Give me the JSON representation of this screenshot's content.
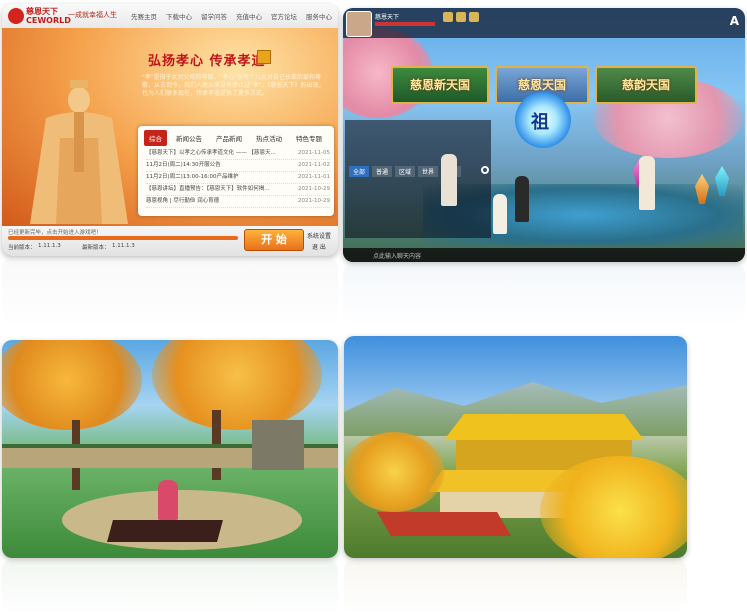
{
  "launcher": {
    "logo_text": "慈恩天下\nCEWORLD",
    "slogan": "一成就幸福人生",
    "nav": [
      "先赛主页",
      "下载中心",
      "留学问答",
      "充值中心",
      "官方论坛",
      "服务中心"
    ],
    "headline": "弘扬孝心 传承孝道",
    "intro": "\"孝\"是指子女对父母的尊敬，\"孝心\"是每个儿女对自己长辈的爱和尊敬，从古到今，我们人类从来没有停止过\"孝\"。《慈恩天下》的出现，也为人们很多现在，传承孝道提供了更多方式。",
    "tabs": [
      "综合",
      "新闻公告",
      "产品新闻",
      "热点活动",
      "特色专题"
    ],
    "active_tab": 0,
    "news": [
      {
        "title": "【慈恩天下】以孝之心传承孝道文化 —— 【慈恩天...",
        "date": "2021-11-05"
      },
      {
        "title": "11月2日(周二)14:30开服公告",
        "date": "2021-11-02"
      },
      {
        "title": "11月2日(周二)13:00-16:00产品维护",
        "date": "2021-11-01"
      },
      {
        "title": "【慈恩讲坛】直播预告：【慈恩天下】软件如何揭...",
        "date": "2021-10-29"
      },
      {
        "title": "慈恩视角 | 尽行勤俭 润心育德",
        "date": "2021-10-29"
      }
    ],
    "status_text": "已经更新完毕，点击开始进入游戏吧！",
    "progress": 1.0,
    "current_version_label": "当前版本：",
    "current_version": "1.11.1.3",
    "latest_version_label": "最新版本：",
    "latest_version": "1.11.1.3",
    "start_label": "开 始",
    "settings_label": "系统设置",
    "exit_label": "退 出"
  },
  "lobby": {
    "player_name": "慈恩天下",
    "a_label": "A",
    "banners": [
      "慈恩新天国",
      "慈恩天国",
      "慈韵天国"
    ],
    "portal_glyph": "祖",
    "chat_tabs": [
      "全部",
      "普通",
      "区域",
      "世界",
      "私聊"
    ],
    "chat_input_placeholder": "点此输入聊天内容",
    "colors": {
      "banner_border": "#e2b24a",
      "portal": "#2f8fe8"
    }
  },
  "garden_scene": {},
  "palace_scene": {}
}
